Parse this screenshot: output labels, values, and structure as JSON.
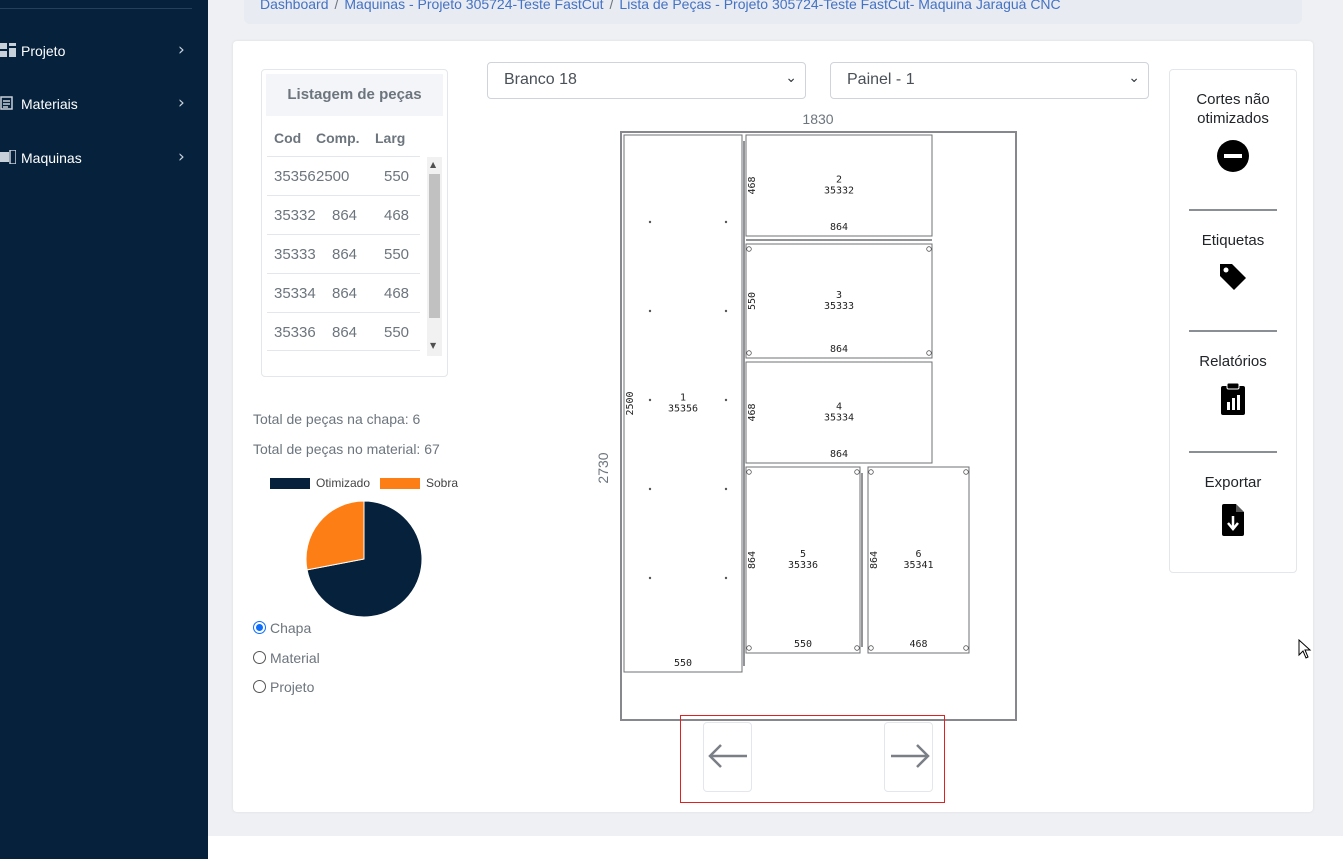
{
  "sidebar": {
    "items": [
      {
        "label": "Projeto",
        "icon": "dashboard-icon"
      },
      {
        "label": "Materiais",
        "icon": "list-icon"
      },
      {
        "label": "Maquinas",
        "icon": "machine-icon"
      }
    ]
  },
  "breadcrumb": {
    "items": [
      "Dashboard",
      "Maquinas - Projeto 305724-Teste FastCut",
      "Lista de Peças - Projeto 305724-Teste FastCut- Maquina Jaraguá CNC"
    ]
  },
  "parts_list": {
    "title": "Listagem de peças",
    "columns": [
      "Cod",
      "Comp.",
      "Larg"
    ],
    "rows": [
      [
        "35356",
        "2500",
        "550"
      ],
      [
        "35332",
        "864",
        "468"
      ],
      [
        "35333",
        "864",
        "550"
      ],
      [
        "35334",
        "864",
        "468"
      ],
      [
        "35336",
        "864",
        "550"
      ]
    ]
  },
  "stats": {
    "pieces_on_sheet": "Total de peças na chapa: 6",
    "pieces_on_material": "Total de peças no material: 67"
  },
  "chart_data": {
    "type": "pie",
    "labels": [
      "Otimizado",
      "Sobra"
    ],
    "values": [
      72,
      28
    ],
    "colors": [
      "#06213c",
      "#fd7e14"
    ],
    "legend": "top"
  },
  "scope_radios": {
    "options": [
      "Chapa",
      "Material",
      "Projeto"
    ],
    "selected": "Chapa"
  },
  "selects": {
    "material": "Branco 18",
    "panel": "Painel - 1"
  },
  "sheet": {
    "width_label": "1830",
    "height_label": "2730",
    "pieces": [
      {
        "num": "1",
        "code": "35356",
        "w": "550",
        "h": "2500"
      },
      {
        "num": "2",
        "code": "35332",
        "w": "864",
        "h": "468"
      },
      {
        "num": "3",
        "code": "35333",
        "w": "864",
        "h": "550"
      },
      {
        "num": "4",
        "code": "35334",
        "w": "864",
        "h": "468"
      },
      {
        "num": "5",
        "code": "35336",
        "w": "550",
        "h": "864"
      },
      {
        "num": "6",
        "code": "35341",
        "w": "468",
        "h": "864"
      }
    ]
  },
  "actions": [
    {
      "label_line1": "Cortes não",
      "label_line2": "otimizados",
      "icon": "minus-circle-icon"
    },
    {
      "label_line1": "Etiquetas",
      "label_line2": "",
      "icon": "tag-icon"
    },
    {
      "label_line1": "Relatórios",
      "label_line2": "",
      "icon": "clipboard-chart-icon"
    },
    {
      "label_line1": "Exportar",
      "label_line2": "",
      "icon": "file-download-icon"
    }
  ],
  "colors": {
    "sidebar_bg": "#06213c",
    "accent": "#fd7e14",
    "link": "#4472c4",
    "highlight_border": "#dd2222"
  }
}
